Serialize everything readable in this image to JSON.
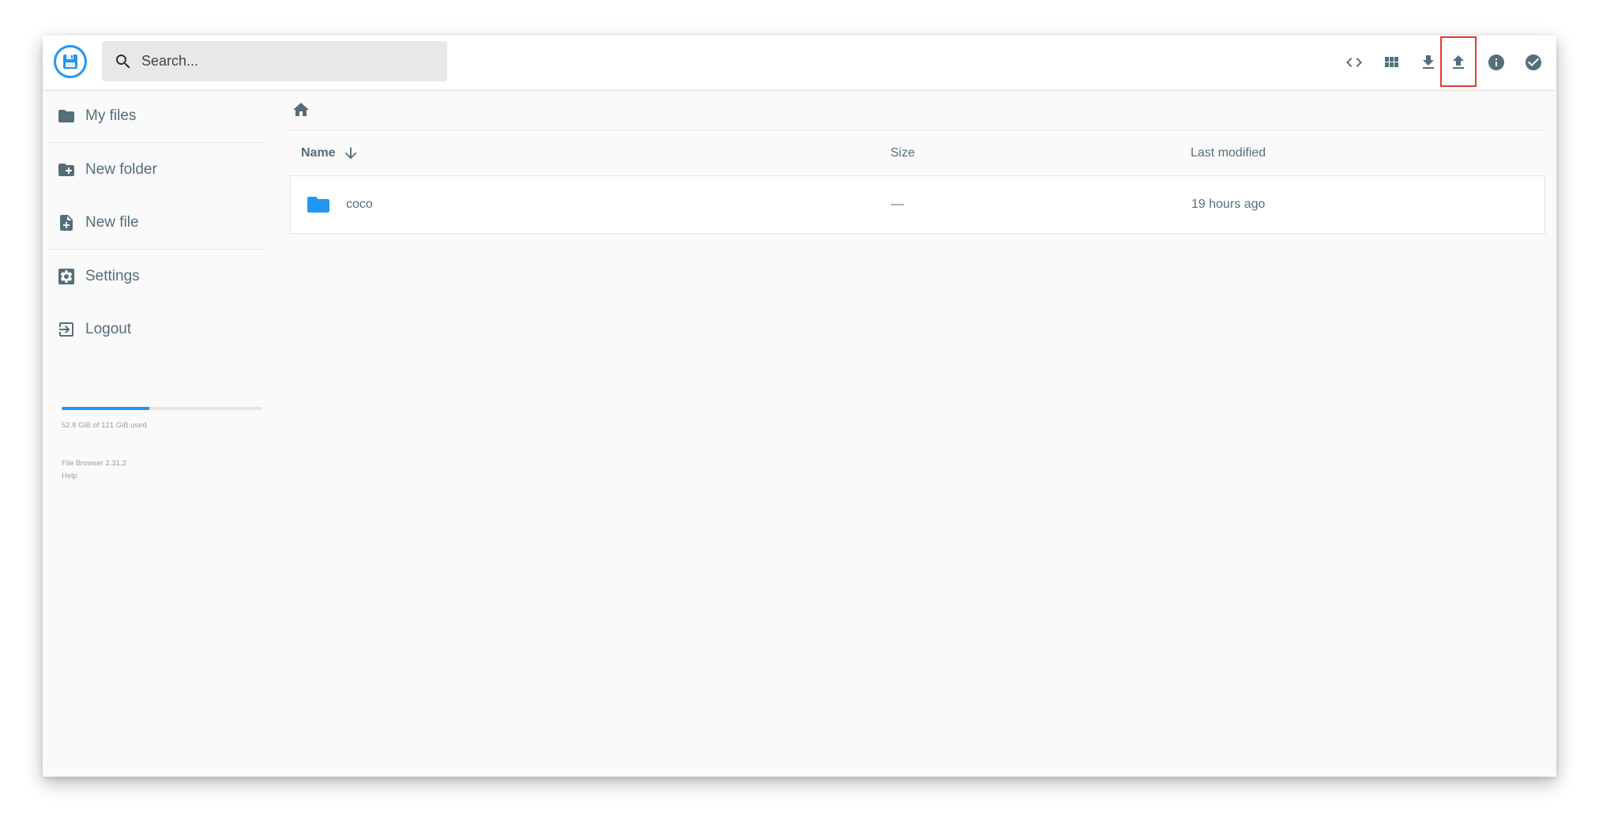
{
  "search": {
    "placeholder": "Search..."
  },
  "toolbar": {
    "actions": [
      {
        "name": "code-view-icon",
        "title": "Switch view"
      },
      {
        "name": "grid-icon",
        "title": "Grid view"
      },
      {
        "name": "download-icon",
        "title": "Download"
      },
      {
        "name": "upload-icon",
        "title": "Upload"
      },
      {
        "name": "info-icon",
        "title": "Info"
      },
      {
        "name": "check-circle-icon",
        "title": "Select multiple"
      }
    ]
  },
  "sidebar": {
    "items": [
      {
        "label": "My files",
        "icon": "folder-icon"
      },
      {
        "label": "New folder",
        "icon": "create-new-folder-icon"
      },
      {
        "label": "New file",
        "icon": "note-add-icon"
      },
      {
        "label": "Settings",
        "icon": "settings-icon"
      },
      {
        "label": "Logout",
        "icon": "exit-icon"
      }
    ],
    "quota": {
      "text": "52.8 GiB of 121 GiB used",
      "fraction": 0.436
    },
    "credits": {
      "version": "File Browser 2.31.2",
      "help": "Help"
    }
  },
  "breadcrumb": {
    "home_icon": "home-icon"
  },
  "list": {
    "columns": {
      "name": "Name",
      "size": "Size",
      "modified": "Last modified"
    },
    "rows": [
      {
        "name": "coco",
        "size": "—",
        "modified": "19 hours ago",
        "icon": "folder-icon"
      }
    ]
  },
  "colors": {
    "accent": "#2196f3",
    "icon": "#546e7a",
    "highlight": "#e53935"
  }
}
